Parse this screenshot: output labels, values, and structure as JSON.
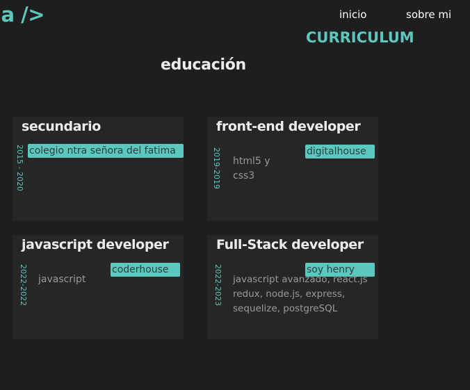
{
  "header": {
    "logo": "ia />",
    "nav": [
      {
        "label": "inicio"
      },
      {
        "label": "sobre mi"
      }
    ],
    "curriculum_label": "CURRICULUM"
  },
  "main": {
    "section_title": "educación",
    "cards": [
      {
        "title": "secundario",
        "dates": "2015 - 2020",
        "institution": "colegio ntra señora del fatima",
        "description": ""
      },
      {
        "title": "front-end developer",
        "dates": "2019-2019",
        "institution": "digitalhouse",
        "description": "html5 y css3"
      },
      {
        "title": "javascript developer",
        "dates": "2022-2022",
        "institution": "coderhouse",
        "description": "javascript"
      },
      {
        "title": "Full-Stack developer",
        "dates": "2022-2023",
        "institution": "soy henry",
        "description": "javascript avanzado, react.js redux, node.js, express, sequelize, postgreSQL"
      }
    ]
  },
  "colors": {
    "background": "#1e1e1e",
    "card": "#262626",
    "accent": "#5cc7bf",
    "heading": "#ececec",
    "muted": "#9a9a9a"
  }
}
